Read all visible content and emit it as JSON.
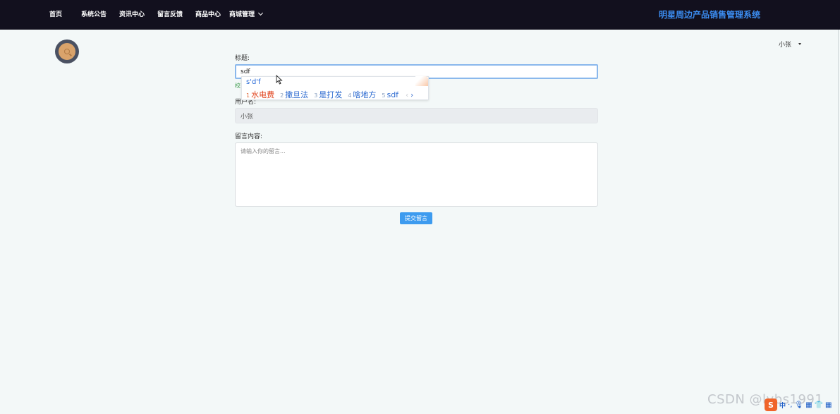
{
  "nav": {
    "items": [
      "首页",
      "系统公告",
      "资讯中心",
      "留言反馈",
      "商品中心"
    ],
    "dropdown_label": "商城管理",
    "site_title": "明星周边产品销售管理系统"
  },
  "user_menu": {
    "name": "小张"
  },
  "form": {
    "title_label": "标题:",
    "title_value": "sdf",
    "title_hint": "校",
    "username_label": "用户名:",
    "username_value": "小张",
    "message_label": "留言内容:",
    "message_placeholder": "请输入你的留言...",
    "submit_label": "提交留言"
  },
  "ime": {
    "composing": "s'd'f",
    "candidates": [
      {
        "num": "1",
        "text": "水电费"
      },
      {
        "num": "2",
        "text": "撒旦法"
      },
      {
        "num": "3",
        "text": "是打发"
      },
      {
        "num": "4",
        "text": "啥地方"
      },
      {
        "num": "5",
        "text": "sdf"
      }
    ],
    "prev": "‹",
    "next": "›"
  },
  "watermark": "CSDN @lybs1991",
  "tray": {
    "logo": "S",
    "mode": "中",
    "icons": [
      "·,",
      "🎙",
      "▦",
      "👕",
      "▦"
    ]
  },
  "colors": {
    "nav_bg": "#12101e",
    "accent": "#3b8cf0",
    "button": "#3d9bef",
    "page_bg": "#f3f8f8"
  }
}
